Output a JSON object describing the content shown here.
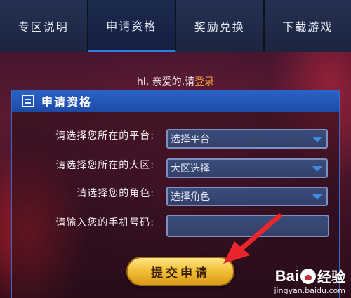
{
  "nav": {
    "tabs": [
      {
        "label": "专区说明",
        "active": false
      },
      {
        "label": "申请资格",
        "active": true
      },
      {
        "label": "奖励兑换",
        "active": false
      },
      {
        "label": "下载游戏",
        "active": false
      }
    ]
  },
  "greeting": {
    "text": "hi, 亲爱的,请",
    "login_link": "登录"
  },
  "panel": {
    "title": "申请资格",
    "icon": "document-icon"
  },
  "form": {
    "platform": {
      "label": "请选择您所在的平台:",
      "value": "选择平台"
    },
    "region": {
      "label": "请选择您所在的大区:",
      "value": "大区选择"
    },
    "role": {
      "label": "请选择您的角色:",
      "value": "选择角色"
    },
    "phone": {
      "label": "请输入您的手机号码:",
      "value": ""
    },
    "submit_label": "提交申请"
  },
  "colors": {
    "accent_blue": "#2f7fe0",
    "button_gold": "#f3c23a",
    "login_orange": "#f0a13a",
    "annotation_red": "#e8262b"
  },
  "watermark": {
    "brand_a": "Bai",
    "brand_b": "经验",
    "url": "jingyan.baidu.com"
  }
}
